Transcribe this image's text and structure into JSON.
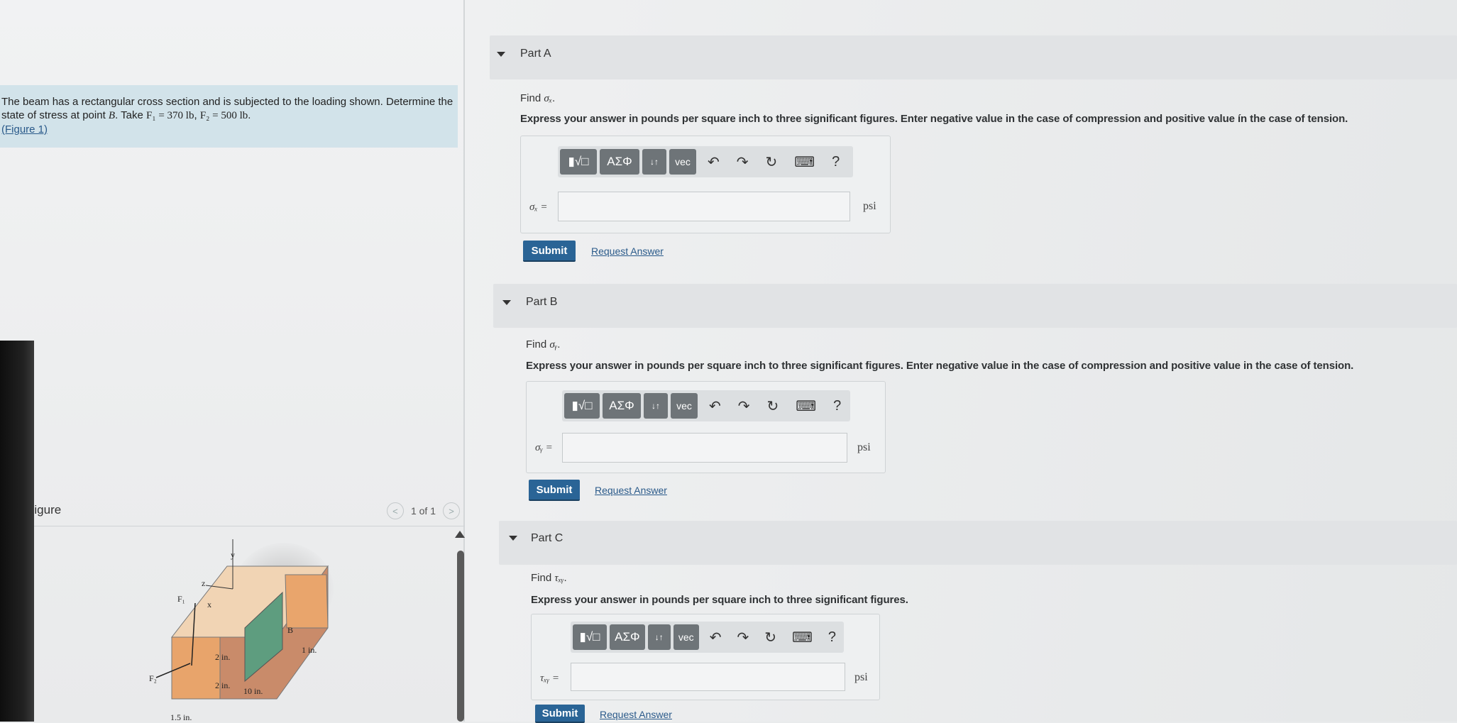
{
  "problem": {
    "line1": "The beam has a rectangular cross section and is subjected to the loading shown. Determine the",
    "line2_pre": "state of stress at point ",
    "point": "B",
    "line2_mid": ". Take ",
    "f1": "F₁ = 370 lb",
    "sep": ", ",
    "f2": "F₂ = 500 lb",
    "end": ".",
    "figure_link": "(Figure 1)"
  },
  "figure": {
    "title": "Figure",
    "pager": "1 of 1",
    "prev": "<",
    "next": ">",
    "labels": {
      "y": "y",
      "z": "z",
      "x": "x",
      "F1": "F₁",
      "F2": "F₂",
      "B": "B",
      "d1": "2 in.",
      "d2": "2 in.",
      "d3": "10 in.",
      "d4": "1 in.",
      "d5": "1.5 in."
    }
  },
  "toolbar": {
    "templates": "▮√□",
    "greek": "ΑΣΦ",
    "arrows": "↓↑",
    "vec": "vec",
    "undo": "↶",
    "redo": "↷",
    "reset": "↻",
    "keyboard": "⌨",
    "help": "?"
  },
  "parts": [
    {
      "title": "Part A",
      "find_pre": "Find ",
      "find_var": "σₓ",
      "find_end": ".",
      "instr": "Express your answer in pounds per square inch to three significant figures. Enter negative value in the case of compression and positive value ín the case of tension.",
      "label": "σₓ =",
      "unit": "psi",
      "submit": "Submit",
      "request": "Request Answer"
    },
    {
      "title": "Part B",
      "find_pre": "Find ",
      "find_var": "σᵧ",
      "find_end": ".",
      "instr": "Express your answer in pounds per square inch to three significant figures. Enter negative value in the case of compression and positive value in the case of tension.",
      "label": "σᵧ =",
      "unit": "psi",
      "submit": "Submit",
      "request": "Request Answer"
    },
    {
      "title": "Part C",
      "find_pre": "Find ",
      "find_var": "τₓᵧ",
      "find_end": ".",
      "instr": "Express your answer in pounds per square inch to three significant figures.",
      "label": "τₓᵧ =",
      "unit": "psi",
      "submit": "Submit",
      "request": "Request Answer"
    }
  ]
}
